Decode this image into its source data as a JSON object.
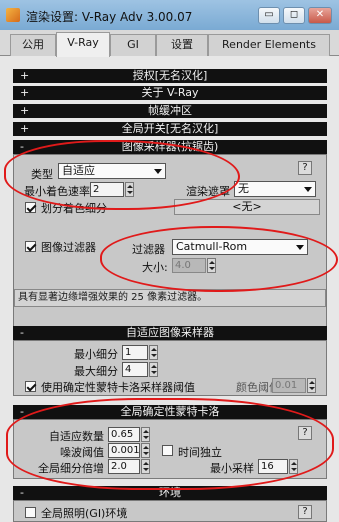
{
  "window": {
    "title": "渲染设置: V-Ray Adv 3.00.07",
    "min_label": "▭",
    "max_label": "◻",
    "close_label": "✕"
  },
  "tabs": [
    "公用",
    "V-Ray",
    "GI",
    "设置",
    "Render Elements"
  ],
  "active_tab": "V-Ray",
  "rollouts": {
    "license": {
      "sign": "+",
      "title": "授权[无名汉化]"
    },
    "about": {
      "sign": "+",
      "title": "关于 V-Ray"
    },
    "framebuffer": {
      "sign": "+",
      "title": "帧缓冲区"
    },
    "global": {
      "sign": "+",
      "title": "全局开关[无名汉化]"
    },
    "image_sampler": {
      "sign": "-",
      "title": "图像采样器(抗锯齿)",
      "type_label": "类型",
      "type_value": "自适应",
      "min_rate_label": "最小着色速率",
      "min_rate_value": "2",
      "render_mask_label": "渲染遮罩",
      "render_mask_value": "无",
      "mask_button": "<无>",
      "subdivide_label": "划分着色细分",
      "subdivide_checked": true,
      "help": "?"
    },
    "image_filter": {
      "filter_checkbox_label": "图像过滤器",
      "filter_checked": true,
      "filter_label": "过滤器",
      "filter_value": "Catmull-Rom",
      "size_label": "大小:",
      "size_value": "4.0",
      "description": "具有显著边缘增强效果的 25 像素过滤器。"
    },
    "adaptive": {
      "sign": "-",
      "title": "自适应图像采样器",
      "min_subdiv_label": "最小细分",
      "min_subdiv_value": "1",
      "max_subdiv_label": "最大细分",
      "max_subdiv_value": "4",
      "use_threshold_label": "使用确定性蒙特卡洛采样器阈值",
      "use_threshold_checked": true,
      "color_threshold_label": "颜色阈值",
      "color_threshold_value": "0.01"
    },
    "dmc": {
      "sign": "-",
      "title": "全局确定性蒙特卡洛",
      "adaptive_amount_label": "自适应数量",
      "adaptive_amount_value": "0.65",
      "noise_label": "噪波阈值",
      "noise_value": "0.001",
      "time_indep_label": "时间独立",
      "time_indep_checked": false,
      "global_mult_label": "全局细分倍增",
      "global_mult_value": "2.0",
      "min_samples_label": "最小采样",
      "min_samples_value": "16",
      "help": "?"
    },
    "environment": {
      "sign": "-",
      "title": "环境",
      "gi_env_label": "全局照明(GI)环境",
      "gi_env_checked": false,
      "help": "?"
    }
  },
  "colors": {
    "annotation": "#e01a1a",
    "rollout_header": "#111111",
    "panel": "#c8c8c8"
  }
}
